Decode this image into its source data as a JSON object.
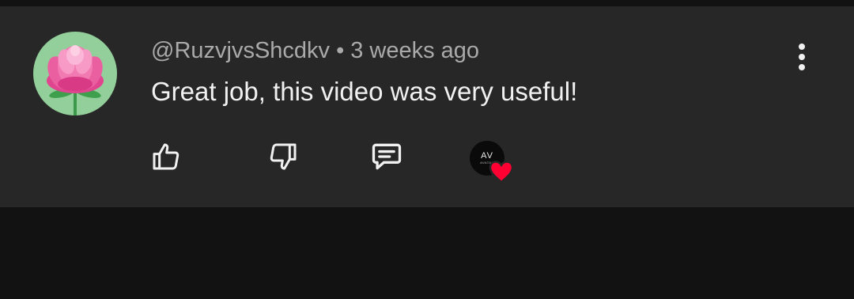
{
  "comment": {
    "author": "@RuzvjvsShcdkv",
    "separator": "•",
    "timestamp": "3 weeks ago",
    "text": "Great job, this video was very useful!"
  },
  "creator": {
    "monogram": "AV",
    "subtext": "AVATAR"
  },
  "icons": {
    "avatar": "lotus-flower-avatar",
    "more": "vertical-ellipsis-icon",
    "like": "thumb-up-icon",
    "dislike": "thumb-down-icon",
    "reply": "comment-reply-icon",
    "heart": "heart-icon"
  },
  "colors": {
    "background": "#121212",
    "card": "#272727",
    "meta_text": "#aaaaaa",
    "comment_text": "#f1f1f1",
    "heart": "#ff0033",
    "avatar_bg": "#93cf9a"
  }
}
